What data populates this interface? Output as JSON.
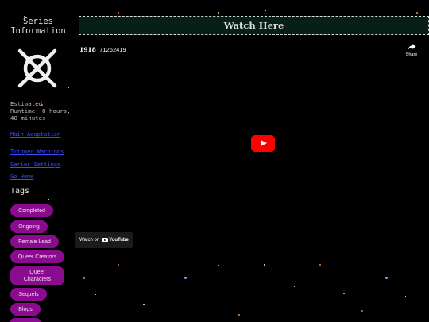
{
  "sidebar": {
    "title": "Series Information",
    "runtime": "Estimated Runtime: 8 hours, 48 minutes",
    "links": [
      "Main Adaptation",
      "Trigger Warnings",
      "Series Settings",
      "Go Home"
    ],
    "tags_heading": "Tags",
    "tags": [
      "Completed",
      "Ongoing",
      "Female Lead",
      "Queer Creators",
      "Queer Characters",
      "Sequels",
      "Blogs"
    ]
  },
  "main": {
    "watch_heading": "Watch Here",
    "video": {
      "title_year": "1918",
      "title_number": "71262419",
      "share_label": "Share",
      "watch_on_label": "Watch on",
      "youtube_label": "YouTube"
    }
  },
  "colors": {
    "background": "#000000",
    "tag_fill": "#8a0b8e",
    "link": "#3d4bff",
    "watch_bar": "#071f17",
    "play_button": "#ff0000"
  },
  "icons": [
    "x-circle-logo-icon",
    "share-icon",
    "play-icon",
    "youtube-icon"
  ]
}
